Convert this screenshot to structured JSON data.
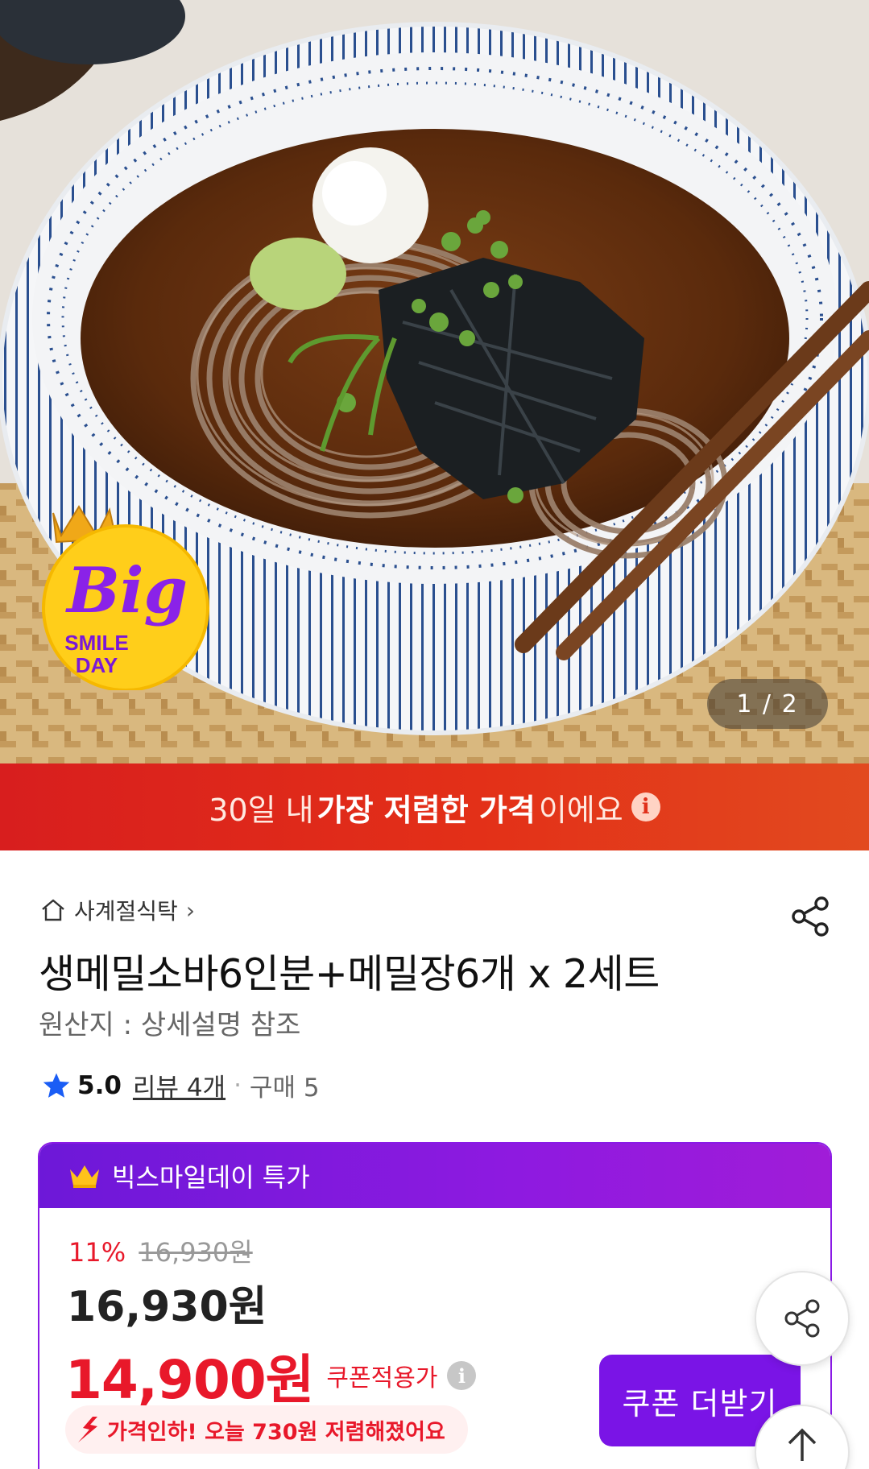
{
  "hero": {
    "counter": "1 / 2",
    "badge": {
      "line1": "Big",
      "line2": "SMILE",
      "line3": "DAY"
    }
  },
  "banner": {
    "prefix": "30일 내",
    "bold": "가장 저렴한 가격",
    "suffix": "이에요"
  },
  "store": {
    "name": "사계절식탁"
  },
  "product": {
    "title": "생메밀소바6인분+메밀장6개 x 2세트",
    "origin": "원산지 : 상세설명 참조"
  },
  "rating": {
    "score": "5.0",
    "reviews": "리뷰 4개",
    "purchases": "구매 5"
  },
  "deal": {
    "header": "빅스마일데이 특가",
    "discount_pct": "11%",
    "original_price": "16,930원",
    "sale_price": "16,930원",
    "coupon_price": "14,900원",
    "coupon_label": "쿠폰적용가",
    "price_drop": "가격인하! 오늘 730원 저렴해졌어요",
    "coupon_button": "쿠폰 더받기"
  },
  "colors": {
    "accent_red": "#e8182a",
    "banner_red": "#d81e1e",
    "purple": "#7a14e6",
    "star_blue": "#1a5df5"
  }
}
